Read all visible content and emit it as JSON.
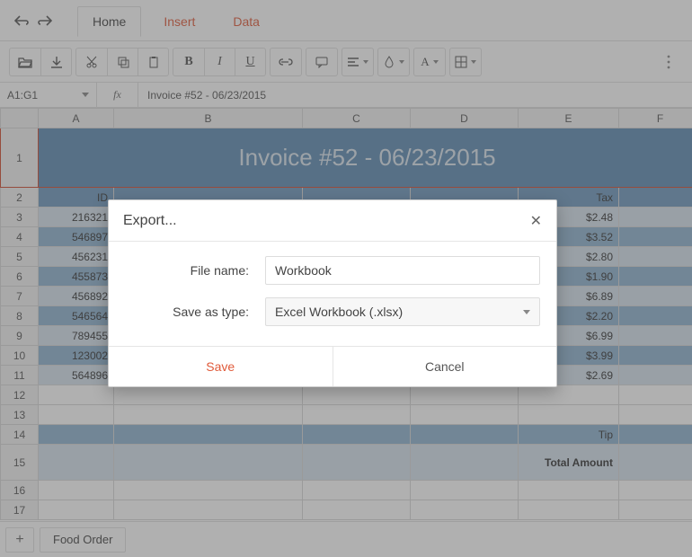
{
  "tabs": {
    "items": [
      "Home",
      "Insert",
      "Data"
    ],
    "active_index": 0
  },
  "name_box": "A1:G1",
  "formula_prefix": "fx",
  "formula_value": "Invoice #52 - 06/23/2015",
  "columns": [
    "A",
    "B",
    "C",
    "D",
    "E",
    "F"
  ],
  "row_numbers": [
    1,
    2,
    3,
    4,
    5,
    6,
    7,
    8,
    9,
    10,
    11,
    12,
    13,
    14,
    15,
    16,
    17
  ],
  "invoice_title": "Invoice #52 - 06/23/2015",
  "headers_row2": {
    "A": "ID",
    "E": "Tax"
  },
  "data_rows": [
    {
      "n": 3,
      "id": "216321",
      "tax": "$2.48"
    },
    {
      "n": 4,
      "id": "546897",
      "tax": "$3.52"
    },
    {
      "n": 5,
      "id": "456231",
      "tax": "$2.80"
    },
    {
      "n": 6,
      "id": "455873",
      "tax": "$1.90"
    },
    {
      "n": 7,
      "id": "456892",
      "tax": "$6.89"
    },
    {
      "n": 8,
      "id": "546564",
      "tax": "$2.20"
    },
    {
      "n": 9,
      "id": "789455",
      "tax": "$6.99"
    },
    {
      "n": 10,
      "id": "123002",
      "tax": "$3.99"
    },
    {
      "n": 11,
      "id": "564896",
      "tax": "$2.69"
    }
  ],
  "row14_label": "Tip",
  "row15_label": "Total Amount",
  "sheet_name": "Food Order",
  "dialog": {
    "title": "Export...",
    "file_name_label": "File name:",
    "file_name_value": "Workbook",
    "save_as_label": "Save as type:",
    "save_as_value": "Excel Workbook (.xlsx)",
    "save": "Save",
    "cancel": "Cancel"
  }
}
